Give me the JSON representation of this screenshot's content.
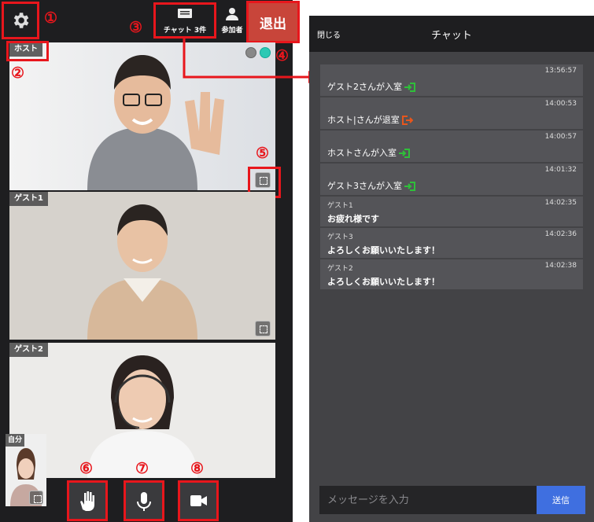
{
  "host_label": "ホスト",
  "guest1_label": "ゲスト1",
  "guest2_label": "ゲスト2",
  "self_label": "自分",
  "chat_button_label": "チャット 3件",
  "participants_label": "参加者",
  "exit_label": "退出",
  "chat_panel": {
    "close_label": "閉じる",
    "title": "チャット",
    "input_placeholder": "メッセージを入力",
    "send_label": "送信"
  },
  "messages": [
    {
      "time": "13:56:57",
      "text": "ゲスト2さんが入室",
      "kind": "enter"
    },
    {
      "time": "14:00:53",
      "text": "ホスト|さんが退室",
      "kind": "exit"
    },
    {
      "time": "14:00:57",
      "text": "ホストさんが入室",
      "kind": "enter"
    },
    {
      "time": "14:01:32",
      "text": "ゲスト3さんが入室",
      "kind": "enter"
    },
    {
      "time": "14:02:35",
      "sender": "ゲスト1",
      "text": "お疲れ様です"
    },
    {
      "time": "14:02:36",
      "sender": "ゲスト3",
      "text": "よろしくお願いいたします！"
    },
    {
      "time": "14:02:38",
      "sender": "ゲスト2",
      "text": "よろしくお願いいたします！"
    }
  ],
  "callouts": [
    "①",
    "②",
    "③",
    "④",
    "⑤",
    "⑥",
    "⑦",
    "⑧"
  ],
  "colors": {
    "highlight": "#e8161c",
    "exit_button": "#c8453a",
    "send_button": "#3f6fe0",
    "enter_icon": "#2fbf3a",
    "exit_icon": "#e8561c"
  }
}
